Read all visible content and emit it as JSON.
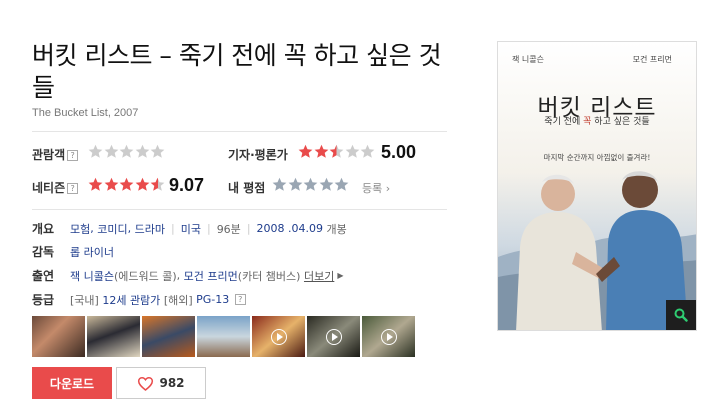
{
  "title": "버킷 리스트 – 죽기 전에 꼭 하고 싶은 것들",
  "subtitle": "The Bucket List, 2007",
  "ratings": {
    "audience_label": "관람객",
    "audience_help": "?",
    "critic_label": "기자·평론가",
    "critic_score": "5.00",
    "critic_value": 5.0,
    "netizen_label": "네티즌",
    "netizen_help": "?",
    "netizen_score": "9.07",
    "netizen_value": 9.07,
    "my_label": "내 평점",
    "register_label": "등록"
  },
  "info": {
    "overview_label": "개요",
    "genres": [
      "모험",
      "코미디",
      "드라마"
    ],
    "country": "미국",
    "runtime": "96분",
    "release_date": "2008 .04.09",
    "release_suffix": "개봉",
    "director_label": "감독",
    "director": "롭 라이너",
    "cast_label": "출연",
    "cast1": "잭 니콜슨",
    "cast1_role": "(에드워드 콜)",
    "cast2": "모건 프리먼",
    "cast2_role": "(카터 챔버스)",
    "more": "더보기",
    "grade_label": "등급",
    "grade_kr_prefix": "[국내]",
    "grade_kr": "12세 관람가",
    "grade_intl_prefix": "[해외]",
    "grade_intl": "PG-13",
    "grade_help": "?"
  },
  "thumbnails": [
    {
      "name": "still-1",
      "video": false
    },
    {
      "name": "still-2",
      "video": false
    },
    {
      "name": "still-3",
      "video": false
    },
    {
      "name": "still-4",
      "video": false
    },
    {
      "name": "video-1",
      "video": true
    },
    {
      "name": "video-2",
      "video": true
    },
    {
      "name": "video-3",
      "video": true
    }
  ],
  "actions": {
    "download_label": "다운로드",
    "like_count": "982"
  },
  "poster": {
    "actor_left": "잭 니콜슨",
    "actor_right": "모건 프리먼",
    "title": "버킷 리스트",
    "subtitle_pre": "죽기 전에 ",
    "subtitle_em": "꼭",
    "subtitle_post": " 하고 싶은 것들",
    "tagline": "마지막 순간까지 아낌없이 즐겨라!"
  },
  "colors": {
    "accent_red": "#e94b4b",
    "link_blue": "#1e3c8c",
    "star_red": "#e94b4b",
    "star_gray": "#cccccc",
    "star_mine": "#9aa6b3"
  },
  "icons": {
    "zoom": "magnifier-icon",
    "like": "heart-icon",
    "play": "play-icon",
    "help": "question-box-icon",
    "chevron": "chevron-right-icon"
  }
}
